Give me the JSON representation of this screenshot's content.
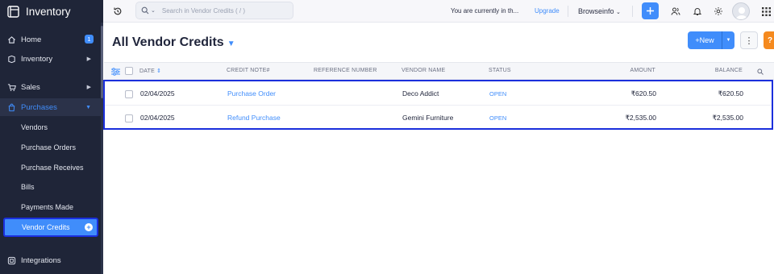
{
  "app": {
    "name": "Inventory"
  },
  "sidebar": {
    "items": [
      {
        "label": "Home",
        "badge": "1"
      },
      {
        "label": "Inventory"
      },
      {
        "label": "Sales"
      },
      {
        "label": "Purchases"
      },
      {
        "label": "Integrations"
      }
    ],
    "purchases_sub": [
      {
        "label": "Vendors"
      },
      {
        "label": "Purchase Orders"
      },
      {
        "label": "Purchase Receives"
      },
      {
        "label": "Bills"
      },
      {
        "label": "Payments Made"
      },
      {
        "label": "Vendor Credits"
      }
    ]
  },
  "topbar": {
    "search_placeholder": "Search in Vendor Credits ( / )",
    "notice": "You are currently in th...",
    "upgrade": "Upgrade",
    "org": "Browseinfo"
  },
  "header": {
    "title": "All Vendor Credits",
    "new_label": "+New",
    "more_label": "⋮",
    "help_label": "?"
  },
  "table": {
    "columns": [
      "DATE",
      "CREDIT NOTE#",
      "REFERENCE NUMBER",
      "VENDOR NAME",
      "STATUS",
      "AMOUNT",
      "BALANCE"
    ],
    "rows": [
      {
        "date": "02/04/2025",
        "credit_note": "Purchase Order",
        "reference": "",
        "vendor": "Deco Addict",
        "status": "OPEN",
        "amount": "₹620.50",
        "balance": "₹620.50"
      },
      {
        "date": "02/04/2025",
        "credit_note": "Refund Purchase",
        "reference": "",
        "vendor": "Gemini Furniture",
        "status": "OPEN",
        "amount": "₹2,535.00",
        "balance": "₹2,535.00"
      }
    ]
  },
  "colors": {
    "accent": "#408dfb",
    "sidebar_bg": "#1f2538",
    "highlight_border": "#1b2fdc",
    "help": "#f58a1f"
  }
}
